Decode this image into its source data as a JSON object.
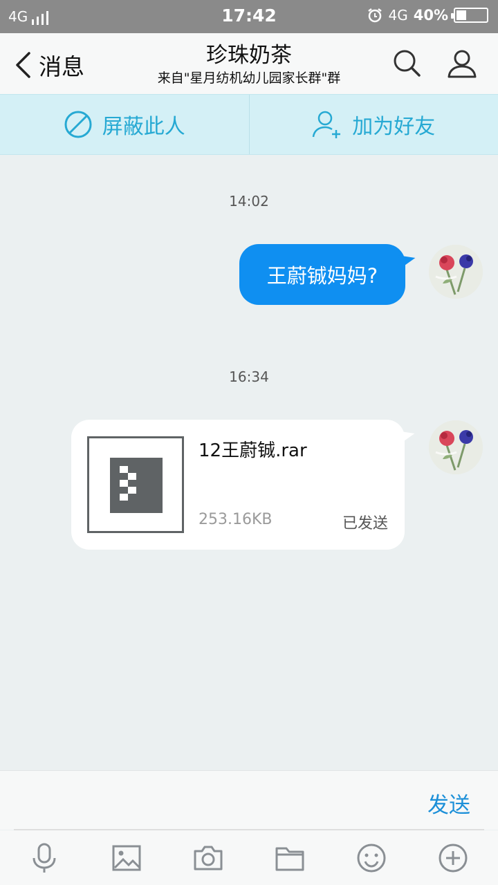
{
  "status_bar": {
    "network_left": "4G",
    "time": "17:42",
    "network_right": "4G",
    "battery": "40%"
  },
  "header": {
    "back_label": "消息",
    "title": "珍珠奶茶",
    "subtitle": "来自\"星月纺机幼儿园家长群\"群"
  },
  "actions": {
    "block_label": "屏蔽此人",
    "add_friend_label": "加为好友"
  },
  "messages": [
    {
      "time": "14:02",
      "text": "王蔚铖妈妈?"
    },
    {
      "time": "16:34",
      "file_name": "12王蔚铖.rar",
      "file_size": "253.16KB",
      "status": "已发送"
    }
  ],
  "input": {
    "send_label": "发送"
  },
  "colors": {
    "accent": "#0f8ff1",
    "action_text": "#26a9d3",
    "send": "#1b8fd8"
  },
  "toolbar_icons": [
    "microphone-icon",
    "image-icon",
    "camera-icon",
    "folder-icon",
    "emoji-icon",
    "plus-icon"
  ]
}
